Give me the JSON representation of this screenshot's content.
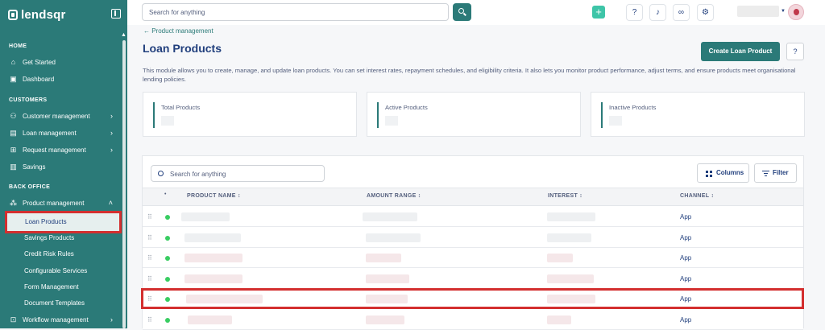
{
  "app": {
    "brand": "lendsqr"
  },
  "sidebar": {
    "sections": {
      "home": "HOME",
      "customers": "CUSTOMERS",
      "back_office": "BACK OFFICE"
    },
    "items": [
      {
        "label": "Get Started",
        "icon": "rocket-icon"
      },
      {
        "label": "Dashboard",
        "icon": "dashboard-icon"
      },
      {
        "label": "Customer management",
        "icon": "users-icon"
      },
      {
        "label": "Loan management",
        "icon": "loan-icon"
      },
      {
        "label": "Request management",
        "icon": "request-icon"
      },
      {
        "label": "Savings",
        "icon": "savings-icon"
      },
      {
        "label": "Product management",
        "icon": "product-icon"
      },
      {
        "label": "Workflow management",
        "icon": "workflow-icon"
      }
    ],
    "sub_items": [
      "Loan Products",
      "Savings Products",
      "Credit Risk Rules",
      "Configurable Services",
      "Form Management",
      "Document Templates"
    ]
  },
  "topbar": {
    "search_placeholder": "Search for anything"
  },
  "main": {
    "breadcrumb": "← Product management",
    "title": "Loan Products",
    "create_button": "Create Loan Product",
    "description": "This module allows you to create, manage, and update loan products. You can set interest rates, repayment schedules, and eligibility criteria. It also lets you monitor product performance, adjust terms, and ensure products meet organisational lending policies.",
    "stats": [
      {
        "label": "Total Products"
      },
      {
        "label": "Active Products"
      },
      {
        "label": "Inactive Products"
      }
    ]
  },
  "table": {
    "search_placeholder": "Search for anything",
    "columns_button": "Columns",
    "filter_button": "Filter",
    "headers": [
      "PRODUCT NAME ↕",
      "AMOUNT RANGE ↕",
      "INTEREST ↕",
      "CHANNEL ↕"
    ],
    "rows": [
      {
        "channel": "App"
      },
      {
        "channel": "App"
      },
      {
        "channel": "App"
      },
      {
        "channel": "App"
      },
      {
        "channel": "App"
      },
      {
        "channel": "App"
      }
    ]
  },
  "colors": {
    "brand": "#2b7a78",
    "accent": "#3ec5a8",
    "highlight": "#d32f2f",
    "active_status": "#39cd62"
  }
}
